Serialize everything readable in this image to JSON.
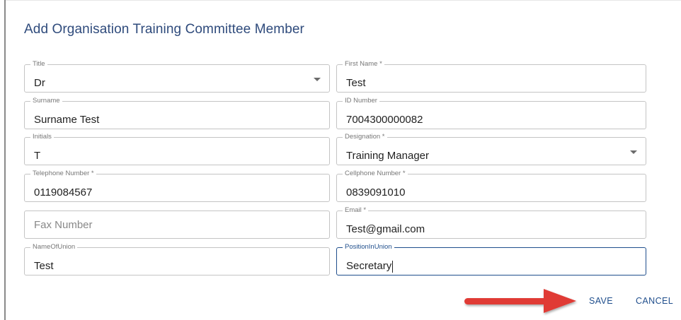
{
  "dialog": {
    "title": "Add Organisation Training Committee Member"
  },
  "fields": {
    "title": {
      "label": "Title",
      "value": "Dr"
    },
    "first_name": {
      "label": "First Name *",
      "value": "Test"
    },
    "surname": {
      "label": "Surname",
      "value": "Surname Test"
    },
    "id_number": {
      "label": "ID Number",
      "value": "7004300000082"
    },
    "initials": {
      "label": "Initials",
      "value": "T"
    },
    "designation": {
      "label": "Designation *",
      "value": "Training Manager"
    },
    "telephone": {
      "label": "Telephone Number *",
      "value": "0119084567"
    },
    "cellphone": {
      "label": "Cellphone Number *",
      "value": "0839091010"
    },
    "fax": {
      "placeholder": "Fax Number"
    },
    "email": {
      "label": "Email *",
      "value": "Test@gmail.com"
    },
    "name_of_union": {
      "label": "NameOfUnion",
      "value": "Test"
    },
    "position_in_union": {
      "label": "PositionInUnion",
      "value": "Secretary"
    }
  },
  "actions": {
    "save_label": "SAVE",
    "cancel_label": "CANCEL"
  },
  "colors": {
    "accent": "#1f4e8c",
    "title": "#2f4b7c",
    "annotation_arrow": "#e03a35"
  }
}
